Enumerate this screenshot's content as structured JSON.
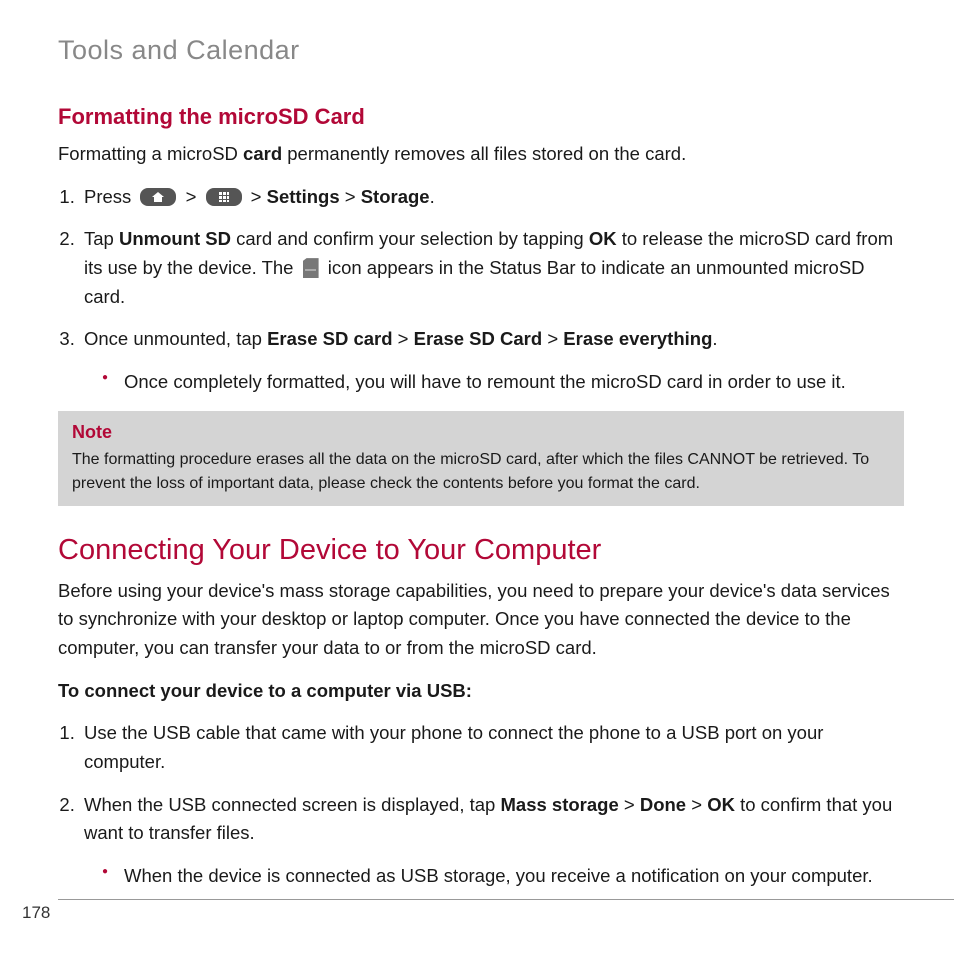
{
  "header": "Tools and Calendar",
  "section1": {
    "title": "Formatting the microSD Card",
    "intro_a": "Formatting a microSD ",
    "intro_b": "card",
    "intro_c": " permanently removes all files stored on the card.",
    "step1_a": "Press ",
    "step1_b": "Settings",
    "step1_c": "Storage",
    "sep": " > ",
    "step2_a": "Tap ",
    "step2_b": "Unmount SD",
    "step2_c": " card and confirm your selection by tapping ",
    "step2_d": "OK",
    "step2_e": " to release the microSD card from its use by the device. The ",
    "step2_f": " icon appears in the Status Bar to indicate an unmounted microSD card.",
    "step3_a": "Once unmounted, tap ",
    "step3_b": "Erase SD card",
    "step3_c": "Erase SD Card",
    "step3_d": "Erase everything",
    "bullet1": "Once completely formatted, you will have to remount the microSD card in order to use it.",
    "note_title": "Note",
    "note_body": "The formatting procedure erases all the data on the microSD card, after which the files CANNOT be retrieved. To prevent the loss of important data, please check the contents before you format the card."
  },
  "section2": {
    "title": "Connecting Your Device to Your Computer",
    "intro": "Before using your device's mass storage capabilities, you need to prepare your device's data services to synchronize with your desktop or laptop computer. Once you have connected the device to the computer, you can transfer your data to or from the microSD card.",
    "subhead": "To connect your device to a computer via USB:",
    "step1": "Use the USB cable that came with your phone to connect the phone to a USB port on your computer.",
    "step2_a": "When the USB connected screen is displayed, tap ",
    "step2_b": "Mass storage",
    "step2_c": "Done",
    "step2_d": "OK",
    "step2_e": " to confirm that you want to transfer files.",
    "sep": " > ",
    "bullet1": "When the device is connected as USB storage, you receive a notification on your computer."
  },
  "page_number": "178"
}
